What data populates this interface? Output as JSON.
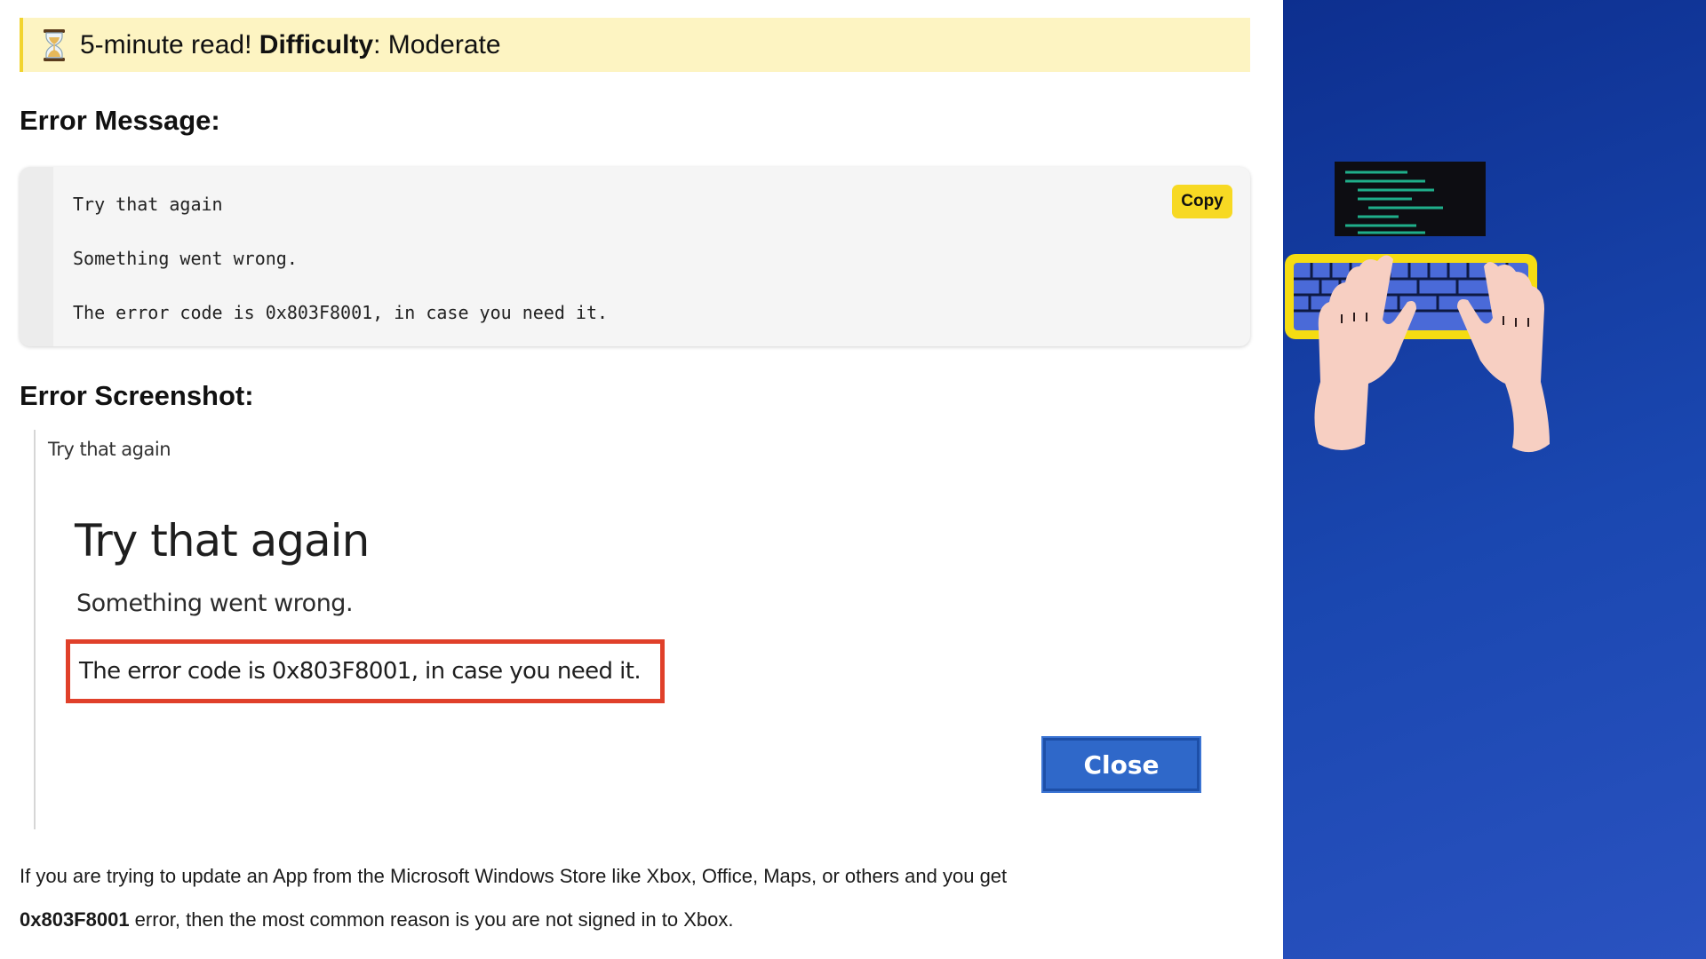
{
  "banner": {
    "icon": "hourglass-icon",
    "read_time": "5-minute read!",
    "difficulty_label": "Difficulty",
    "difficulty_value": ": Moderate",
    "background_color": "#fdf4c2",
    "accent_color": "#f2d42e"
  },
  "error_message": {
    "heading": "Error Message:",
    "lines": [
      "Try that again",
      "Something went wrong.",
      "The error code is 0x803F8001, in case you need it."
    ],
    "copy_label": "Copy",
    "copy_button_color": "#f7d923"
  },
  "error_screenshot": {
    "heading": "Error Screenshot:",
    "window_title": "Try that again",
    "dialog_heading": "Try that again",
    "dialog_subtext": "Something went wrong.",
    "dialog_error_code": "The error code is 0x803F8001, in case you need it.",
    "close_label": "Close",
    "highlight_color": "#e0402a",
    "close_button_color": "#2f68c9"
  },
  "explanation": {
    "text_before": "If you are trying to update an App from the Microsoft Windows Store like Xbox, Office, Maps, or others and you get",
    "error_code": "0x803F8001",
    "text_after": " error, then the most common reason is you are not signed in to Xbox."
  },
  "side_panel": {
    "illustration": "typing-hands-keyboard-illustration",
    "background_color": "#1a47b0"
  }
}
